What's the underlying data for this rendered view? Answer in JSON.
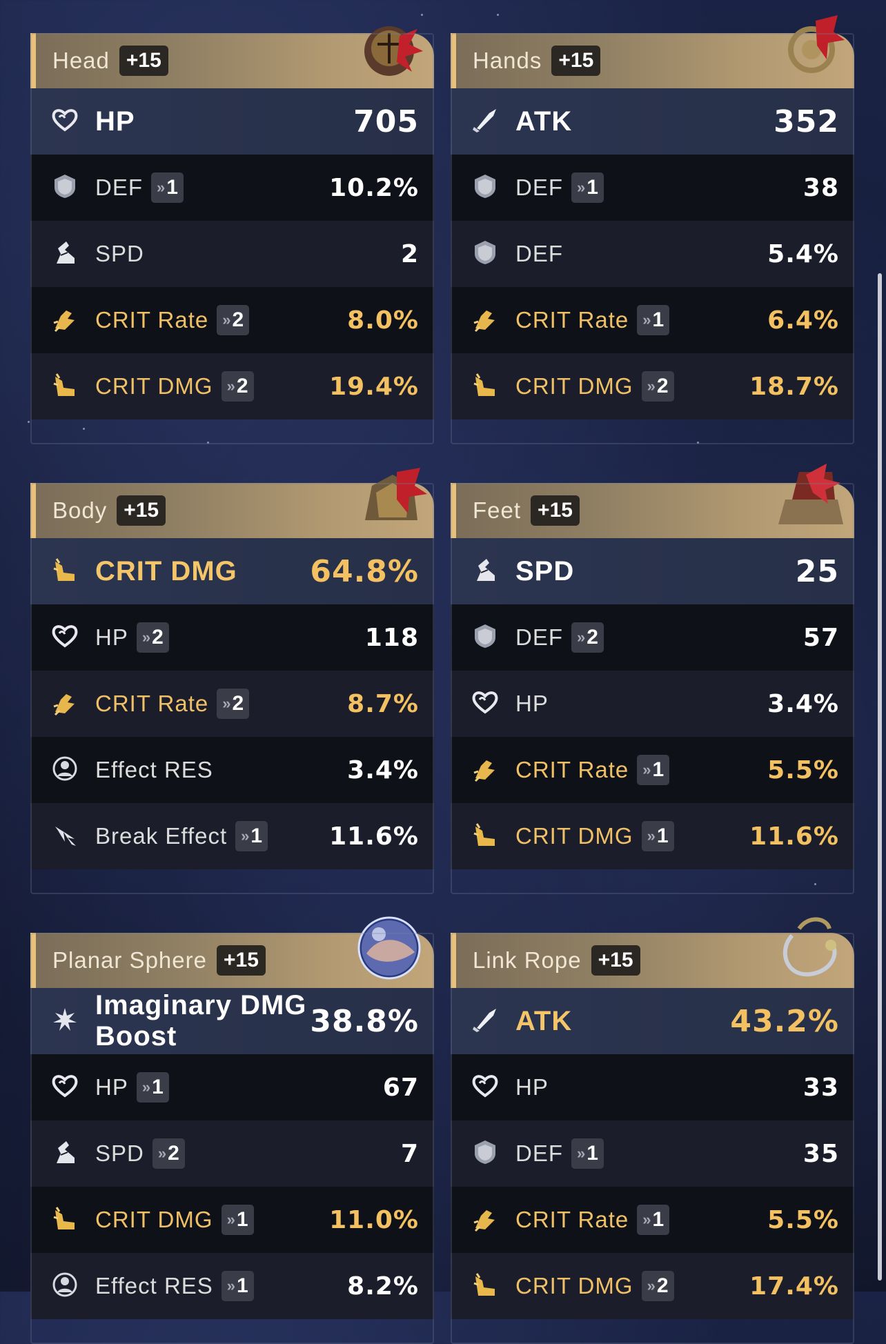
{
  "cards": [
    {
      "slot": "Head",
      "level": "+15",
      "main": {
        "name": "HP",
        "value": "705",
        "icon": "heart-icon",
        "gold": false
      },
      "subs": [
        {
          "name": "DEF",
          "roll": "1",
          "value": "10.2%",
          "icon": "shield-icon",
          "gold": false
        },
        {
          "name": "SPD",
          "roll": "",
          "value": "2",
          "icon": "boot-icon",
          "gold": false
        },
        {
          "name": "CRIT Rate",
          "roll": "2",
          "value": "8.0%",
          "icon": "crit-rate-icon",
          "gold": true
        },
        {
          "name": "CRIT DMG",
          "roll": "2",
          "value": "19.4%",
          "icon": "crit-dmg-icon",
          "gold": true
        }
      ]
    },
    {
      "slot": "Hands",
      "level": "+15",
      "main": {
        "name": "ATK",
        "value": "352",
        "icon": "sword-icon",
        "gold": false
      },
      "subs": [
        {
          "name": "DEF",
          "roll": "1",
          "value": "38",
          "icon": "shield-icon",
          "gold": false
        },
        {
          "name": "DEF",
          "roll": "",
          "value": "5.4%",
          "icon": "shield-icon",
          "gold": false
        },
        {
          "name": "CRIT Rate",
          "roll": "1",
          "value": "6.4%",
          "icon": "crit-rate-icon",
          "gold": true
        },
        {
          "name": "CRIT DMG",
          "roll": "2",
          "value": "18.7%",
          "icon": "crit-dmg-icon",
          "gold": true
        }
      ]
    },
    {
      "slot": "Body",
      "level": "+15",
      "main": {
        "name": "CRIT DMG",
        "value": "64.8%",
        "icon": "crit-dmg-icon",
        "gold": true
      },
      "subs": [
        {
          "name": "HP",
          "roll": "2",
          "value": "118",
          "icon": "heart-icon",
          "gold": false
        },
        {
          "name": "CRIT Rate",
          "roll": "2",
          "value": "8.7%",
          "icon": "crit-rate-icon",
          "gold": true
        },
        {
          "name": "Effect RES",
          "roll": "",
          "value": "3.4%",
          "icon": "effect-res-icon",
          "gold": false
        },
        {
          "name": "Break Effect",
          "roll": "1",
          "value": "11.6%",
          "icon": "break-effect-icon",
          "gold": false
        }
      ]
    },
    {
      "slot": "Feet",
      "level": "+15",
      "main": {
        "name": "SPD",
        "value": "25",
        "icon": "boot-icon",
        "gold": false
      },
      "subs": [
        {
          "name": "DEF",
          "roll": "2",
          "value": "57",
          "icon": "shield-icon",
          "gold": false
        },
        {
          "name": "HP",
          "roll": "",
          "value": "3.4%",
          "icon": "heart-icon",
          "gold": false
        },
        {
          "name": "CRIT Rate",
          "roll": "1",
          "value": "5.5%",
          "icon": "crit-rate-icon",
          "gold": true
        },
        {
          "name": "CRIT DMG",
          "roll": "1",
          "value": "11.6%",
          "icon": "crit-dmg-icon",
          "gold": true
        }
      ]
    },
    {
      "slot": "Planar Sphere",
      "level": "+15",
      "main": {
        "name": "Imaginary DMG Boost",
        "value": "38.8%",
        "icon": "imaginary-icon",
        "gold": false,
        "small": true
      },
      "subs": [
        {
          "name": "HP",
          "roll": "1",
          "value": "67",
          "icon": "heart-icon",
          "gold": false
        },
        {
          "name": "SPD",
          "roll": "2",
          "value": "7",
          "icon": "boot-icon",
          "gold": false
        },
        {
          "name": "CRIT DMG",
          "roll": "1",
          "value": "11.0%",
          "icon": "crit-dmg-icon",
          "gold": true
        },
        {
          "name": "Effect RES",
          "roll": "1",
          "value": "8.2%",
          "icon": "effect-res-icon",
          "gold": false
        }
      ]
    },
    {
      "slot": "Link Rope",
      "level": "+15",
      "main": {
        "name": "ATK",
        "value": "43.2%",
        "icon": "sword-icon",
        "gold": true
      },
      "subs": [
        {
          "name": "HP",
          "roll": "",
          "value": "33",
          "icon": "heart-icon",
          "gold": false
        },
        {
          "name": "DEF",
          "roll": "1",
          "value": "35",
          "icon": "shield-icon",
          "gold": false
        },
        {
          "name": "CRIT Rate",
          "roll": "1",
          "value": "5.5%",
          "icon": "crit-rate-icon",
          "gold": true
        },
        {
          "name": "CRIT DMG",
          "roll": "2",
          "value": "17.4%",
          "icon": "crit-dmg-icon",
          "gold": true
        }
      ]
    }
  ],
  "roll_prefix": "»",
  "colors": {
    "gold": "#f3c162",
    "header_accent": "#e9c17a",
    "white": "#ffffff"
  }
}
